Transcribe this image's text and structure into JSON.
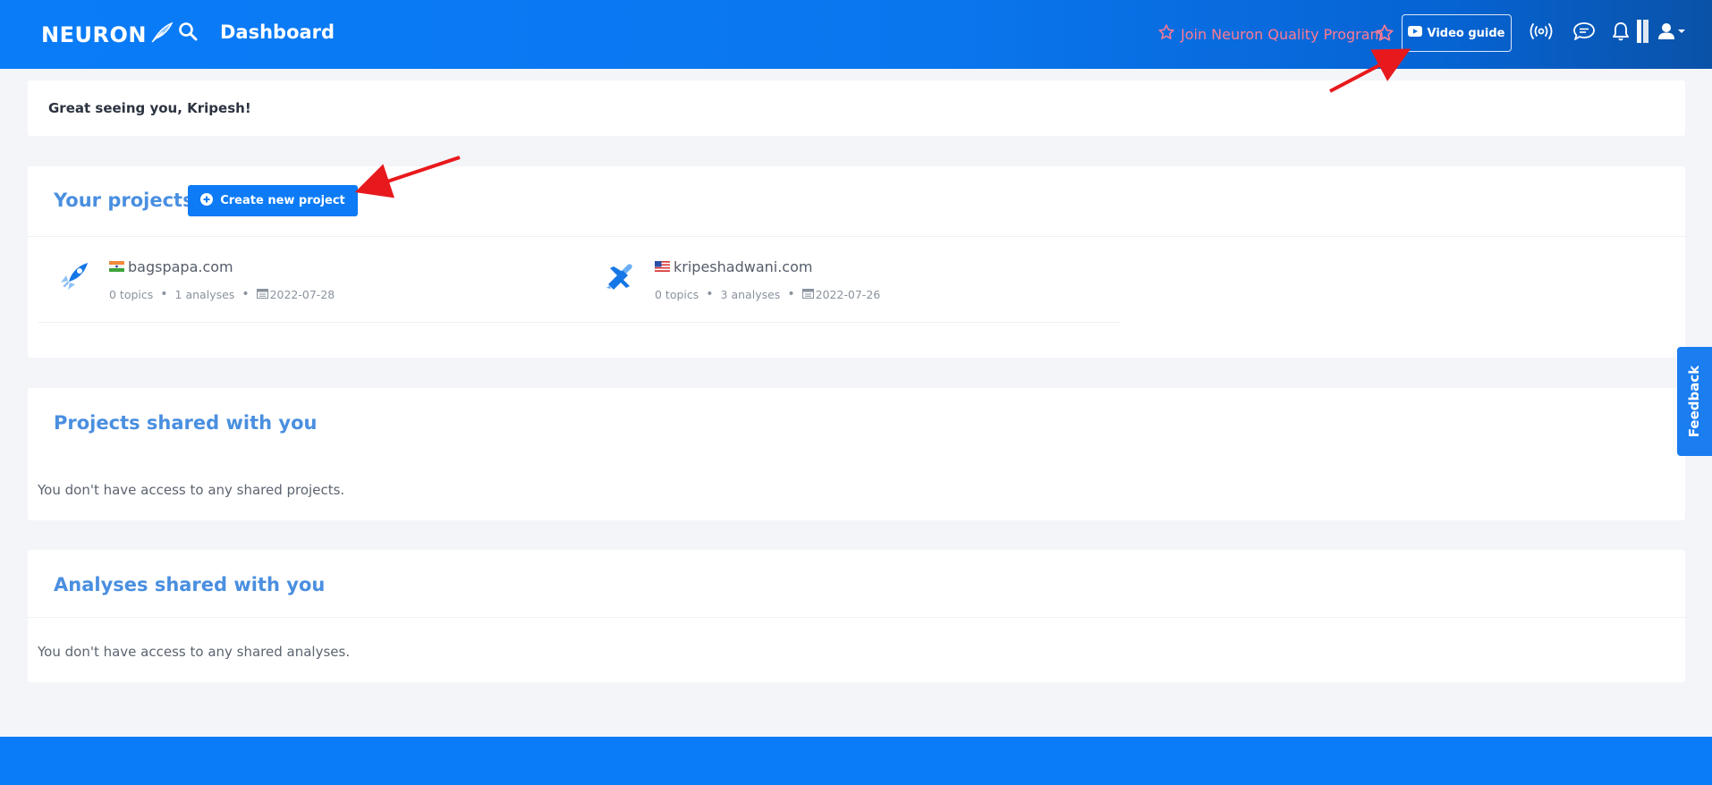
{
  "header": {
    "logo": "NEURON",
    "title": "Dashboard",
    "join_program": "Join Neuron Quality Program",
    "video_guide": "Video guide",
    "icons": [
      "search-icon",
      "star-icon",
      "youtube-icon",
      "broadcast-icon",
      "chat-icon",
      "bell-icon",
      "bars-icon",
      "user-icon",
      "chevron-down-icon"
    ],
    "brand_color": "#0a7cf8",
    "accent_color": "#ff7a93"
  },
  "greeting": "Great seeing you, Kripesh!",
  "projects": {
    "title": "Your projects",
    "create_label": "Create new project",
    "items": [
      {
        "domain": "bagspapa.com",
        "flag": "IN",
        "topics": "0 topics",
        "analyses": "1 analyses",
        "date": "2022-07-28",
        "icon": "rocket-icon"
      },
      {
        "domain": "kripeshadwani.com",
        "flag": "US",
        "topics": "0 topics",
        "analyses": "3 analyses",
        "date": "2022-07-26",
        "icon": "plane-icon"
      }
    ]
  },
  "shared_projects": {
    "title": "Projects shared with you",
    "empty": "You don't have access to any shared projects."
  },
  "shared_analyses": {
    "title": "Analyses shared with you",
    "empty": "You don't have access to any shared analyses."
  },
  "feedback": "Feedback",
  "annotation_color": "#e8191c"
}
